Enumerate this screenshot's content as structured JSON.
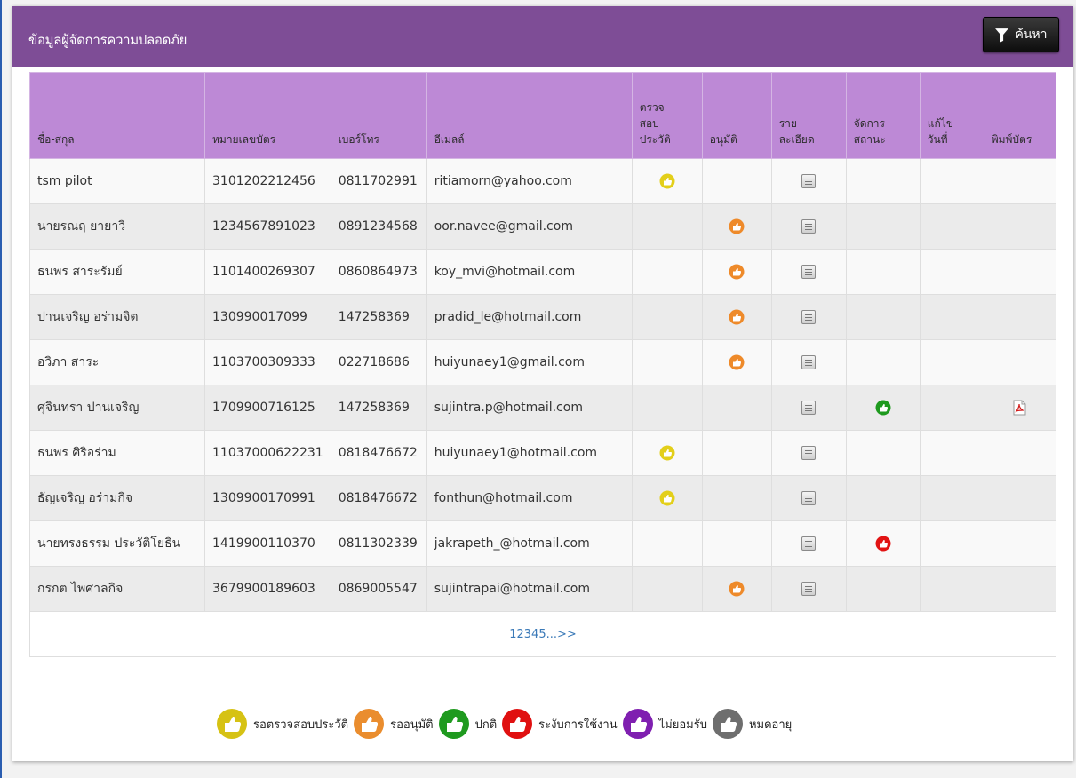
{
  "panel": {
    "title": "ข้อมูลผู้จัดการความปลอดภัย",
    "search_label": "ค้นหา"
  },
  "columns": [
    "ชื่อ-สกุล",
    "หมายเลขบัตร",
    "เบอร์โทร",
    "อีเมลล์",
    "ตรวจ สอบ ประวัติ",
    "อนุมัติ",
    "ราย ละเอียด",
    "จัดการ สถานะ",
    "แก้ไข วันที่",
    "พิมพ์บัตร"
  ],
  "rows": [
    {
      "name": "tsm pilot",
      "card": "3101202212456",
      "phone": "0811702991",
      "email": "ritiamorn@yahoo.com",
      "check": "yellow",
      "approve": "",
      "manage": "",
      "print": false
    },
    {
      "name": "นายรณฤ ยายาวิ",
      "card": "1234567891023",
      "phone": "0891234568",
      "email": "oor.navee@gmail.com",
      "check": "",
      "approve": "orange",
      "manage": "",
      "print": false
    },
    {
      "name": "ธนพร สาระรัมย์",
      "card": "1101400269307",
      "phone": "0860864973",
      "email": "koy_mvi@hotmail.com",
      "check": "",
      "approve": "orange",
      "manage": "",
      "print": false
    },
    {
      "name": "ปานเจริญ  อร่ามจิต",
      "card": "130990017099",
      "phone": "147258369",
      "email": "pradid_le@hotmail.com",
      "check": "",
      "approve": "orange",
      "manage": "",
      "print": false
    },
    {
      "name": "อวิภา สาระ",
      "card": "1103700309333",
      "phone": "022718686",
      "email": "huiyunaey1@gmail.com",
      "check": "",
      "approve": "orange",
      "manage": "",
      "print": false
    },
    {
      "name": "ศุจินทรา ปานเจริญ",
      "card": "1709900716125",
      "phone": "147258369",
      "email": "sujintra.p@hotmail.com",
      "check": "",
      "approve": "",
      "manage": "green",
      "print": true
    },
    {
      "name": "ธนพร   ศิริอร่าม",
      "card": "11037000622231",
      "phone": "0818476672",
      "email": "huiyunaey1@hotmail.com",
      "check": "yellow",
      "approve": "",
      "manage": "",
      "print": false
    },
    {
      "name": "ธัญเจริญ   อร่ามกิจ",
      "card": "1309900170991",
      "phone": "0818476672",
      "email": "fonthun@hotmail.com",
      "check": "yellow",
      "approve": "",
      "manage": "",
      "print": false
    },
    {
      "name": "นายทรงธรรม ประวัติโยธิน",
      "card": "1419900110370",
      "phone": "0811302339",
      "email": "jakrapeth_@hotmail.com",
      "check": "",
      "approve": "",
      "manage": "red",
      "print": false
    },
    {
      "name": "กรกต   ไพศาลกิจ",
      "card": "3679900189603",
      "phone": "0869005547",
      "email": "sujintrapai@hotmail.com",
      "check": "",
      "approve": "orange",
      "manage": "",
      "print": false
    }
  ],
  "pager": {
    "pages": [
      "1",
      "2",
      "3",
      "4",
      "5"
    ],
    "more": "...>>"
  },
  "legend": [
    {
      "label": "รอตรวจสอบประวัติ",
      "color": "#d6c214"
    },
    {
      "label": "รออนุมัติ",
      "color": "#ea8d2e"
    },
    {
      "label": "ปกติ",
      "color": "#1f9a1f"
    },
    {
      "label": "ระงับการใช้งาน",
      "color": "#e01010"
    },
    {
      "label": "ไม่ยอมรับ",
      "color": "#7f1fb0"
    },
    {
      "label": "หมดอายุ",
      "color": "#6e6e6e"
    }
  ],
  "status_colors": {
    "yellow": "#e3cf1a",
    "orange": "#ee8a2a",
    "green": "#1e9a1e",
    "red": "#e21414"
  },
  "icons": {
    "search": "filter-icon",
    "detail": "document-icon",
    "print": "pdf-icon",
    "status": "thumbs-up-icon"
  }
}
